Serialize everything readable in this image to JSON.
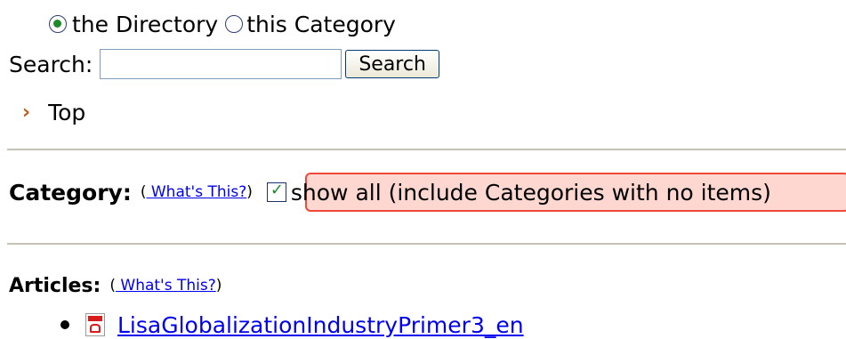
{
  "scope": {
    "options": [
      {
        "label": "the Directory",
        "checked": true
      },
      {
        "label": "this Category",
        "checked": false
      }
    ]
  },
  "search": {
    "label": "Search:",
    "value": "",
    "placeholder": "",
    "button_label": "Search"
  },
  "breadcrumb": {
    "chevron": "›",
    "item": "Top"
  },
  "category": {
    "label": "Category:",
    "whats_this_open": "(",
    "whats_this_link": " What's This?",
    "whats_this_close": ")",
    "show_all_checked": true,
    "show_all_label": "show all (include Categories with no items)"
  },
  "articles": {
    "label": "Articles:",
    "whats_this_open": "(",
    "whats_this_link": " What's This?",
    "whats_this_close": ")",
    "items": [
      {
        "title": "LisaGlobalizationIndustryPrimer3_en",
        "icon": "pdf-icon"
      }
    ]
  },
  "colors": {
    "link": "#0000ee",
    "highlight_border": "#ee4a3a",
    "highlight_fill": "#fdd7d0",
    "chevron": "#c05a14"
  }
}
